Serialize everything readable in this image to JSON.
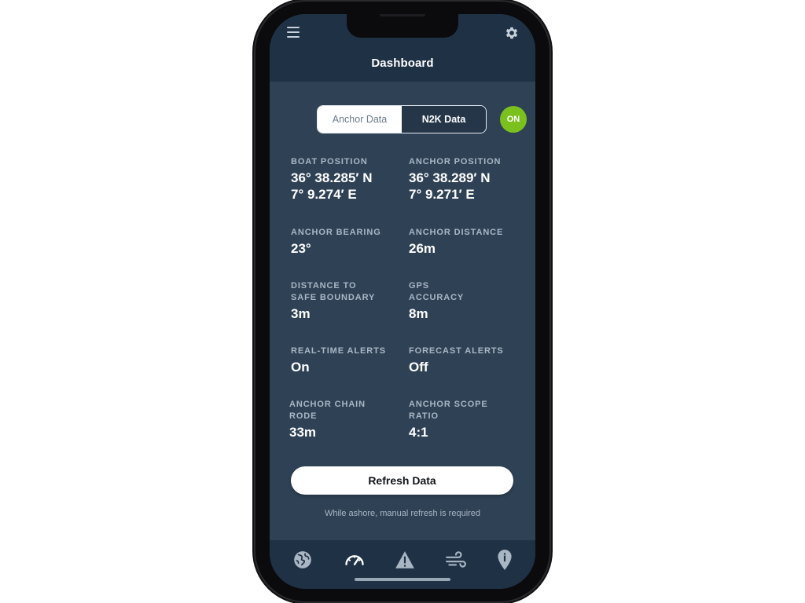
{
  "header": {
    "title": "Dashboard",
    "menu_icon": "hamburger-menu-icon",
    "settings_icon": "gear-icon"
  },
  "tabs": {
    "anchor": "Anchor Data",
    "n2k": "N2K Data",
    "selected": "N2K Data"
  },
  "status": {
    "label": "ON",
    "color": "#7ac11d"
  },
  "stats": {
    "boat_position": {
      "label": "BOAT POSITION",
      "line1": "36° 38.285′ N",
      "line2": "7° 9.274′ E"
    },
    "anchor_position": {
      "label": "ANCHOR POSITION",
      "line1": "36° 38.289′ N",
      "line2": "7° 9.271′ E"
    },
    "anchor_bearing": {
      "label": "ANCHOR BEARING",
      "value": "23°"
    },
    "anchor_distance": {
      "label": "ANCHOR DISTANCE",
      "value": "26m"
    },
    "distance_safe": {
      "label1": "DISTANCE TO",
      "label2": "SAFE BOUNDARY",
      "value": "3m"
    },
    "gps_accuracy": {
      "label1": "GPS",
      "label2": "ACCURACY",
      "value": "8m"
    },
    "realtime_alerts": {
      "label": "REAL-TIME ALERTS",
      "value": "On"
    },
    "forecast_alerts": {
      "label": "FORECAST ALERTS",
      "value": "Off"
    },
    "chain_rode": {
      "label1": "ANCHOR CHAIN",
      "label2": "RODE",
      "value": "33m"
    },
    "scope_ratio": {
      "label1": "ANCHOR SCOPE",
      "label2": "RATIO",
      "value": "4:1"
    }
  },
  "refresh": {
    "button": "Refresh Data",
    "note": "While ashore, manual refresh is required"
  },
  "nav": {
    "items": [
      "globe-icon",
      "speedometer-icon",
      "warning-icon",
      "wind-icon",
      "location-pin-icon"
    ],
    "active": "speedometer-icon"
  },
  "colors": {
    "screen_bg": "#2f4255",
    "header_bg": "#1f3145",
    "accent_on": "#7ac11d",
    "label": "#a9b6c4"
  }
}
